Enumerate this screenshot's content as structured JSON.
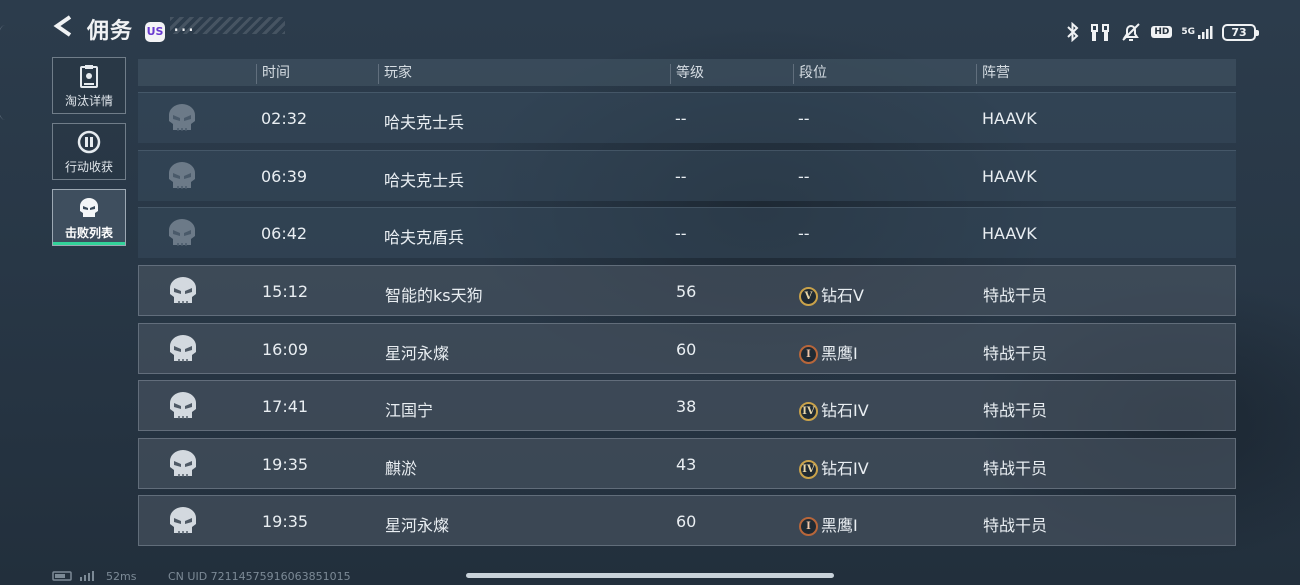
{
  "header": {
    "title": "佣务",
    "badge": "US",
    "more": "···"
  },
  "status_bar": {
    "hd": "HD",
    "network": "5G",
    "battery": "73",
    "icons": [
      "bluetooth-icon",
      "earbuds-icon",
      "silent-icon",
      "hd-icon",
      "signal-5g-icon",
      "battery-icon"
    ]
  },
  "sidebar": {
    "tabs": [
      {
        "label": "淘汰详情",
        "icon": "clipboard-icon",
        "active": false
      },
      {
        "label": "行动收获",
        "icon": "loot-icon",
        "active": false
      },
      {
        "label": "击败列表",
        "icon": "skull-icon",
        "active": true
      }
    ],
    "active_color": "#33d39a"
  },
  "table": {
    "columns": [
      "时间",
      "玩家",
      "等级",
      "段位",
      "阵营"
    ],
    "rows": [
      {
        "time": "02:32",
        "player": "哈夫克士兵",
        "level": "--",
        "rank_badge": "",
        "rank": "--",
        "faction": "HAAVK",
        "style": "dim"
      },
      {
        "time": "06:39",
        "player": "哈夫克士兵",
        "level": "--",
        "rank_badge": "",
        "rank": "--",
        "faction": "HAAVK",
        "style": "dim"
      },
      {
        "time": "06:42",
        "player": "哈夫克盾兵",
        "level": "--",
        "rank_badge": "",
        "rank": "--",
        "faction": "HAAVK",
        "style": "dim"
      },
      {
        "time": "15:12",
        "player": "智能的ks天狗",
        "level": "56",
        "rank_badge": "V",
        "rank": "钻石V",
        "faction": "特战干员",
        "style": "hi"
      },
      {
        "time": "16:09",
        "player": "星河永燦",
        "level": "60",
        "rank_badge": "I",
        "rank": "黑鹰I",
        "faction": "特战干员",
        "style": "hi"
      },
      {
        "time": "17:41",
        "player": "江国宁",
        "level": "38",
        "rank_badge": "IV",
        "rank": "钻石IV",
        "faction": "特战干员",
        "style": "hi"
      },
      {
        "time": "19:35",
        "player": "麒淤",
        "level": "43",
        "rank_badge": "IV",
        "rank": "钻石IV",
        "faction": "特战干员",
        "style": "hi"
      },
      {
        "time": "19:35",
        "player": "星河永燦",
        "level": "60",
        "rank_badge": "I",
        "rank": "黑鹰I",
        "faction": "特战干员",
        "style": "hi"
      }
    ]
  },
  "footer": {
    "ping": "52ms",
    "uid": "CN UID 72114575916063851015"
  }
}
